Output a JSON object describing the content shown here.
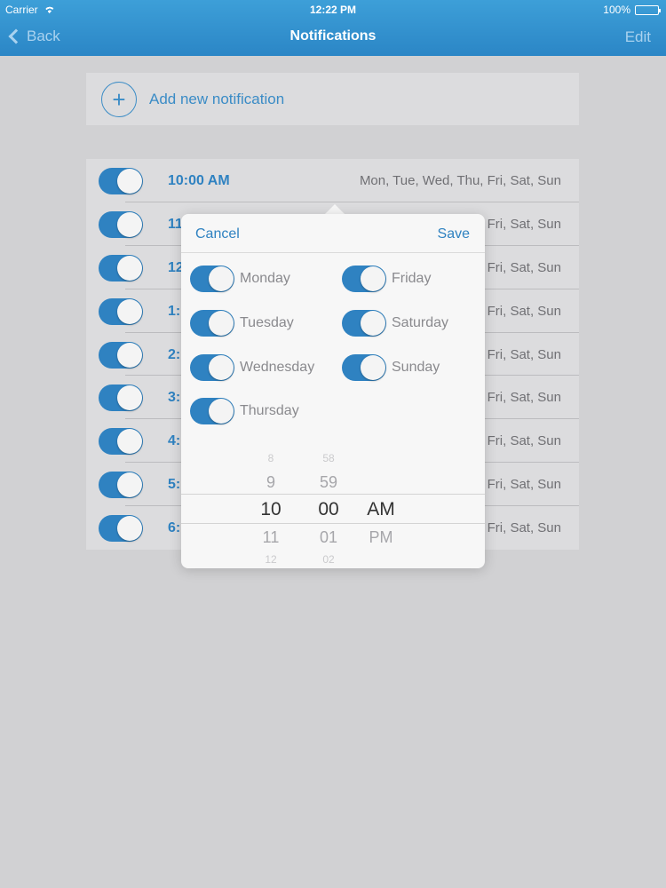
{
  "status": {
    "carrier": "Carrier",
    "time": "12:22 PM",
    "battery": "100%"
  },
  "nav": {
    "back": "Back",
    "title": "Notifications",
    "edit": "Edit"
  },
  "add": {
    "label": "Add new notification",
    "plus": "+"
  },
  "list": [
    {
      "time": "10:00 AM",
      "days": "Mon, Tue, Wed, Thu, Fri, Sat, Sun"
    },
    {
      "time": "11",
      "days": "Fri, Sat, Sun"
    },
    {
      "time": "12",
      "days": "Fri, Sat, Sun"
    },
    {
      "time": "1:",
      "days": "Fri, Sat, Sun"
    },
    {
      "time": "2:",
      "days": "Fri, Sat, Sun"
    },
    {
      "time": "3:",
      "days": "Fri, Sat, Sun"
    },
    {
      "time": "4:",
      "days": "Fri, Sat, Sun"
    },
    {
      "time": "5:",
      "days": "Fri, Sat, Sun"
    },
    {
      "time": "6:",
      "days": "Fri, Sat, Sun"
    }
  ],
  "popover": {
    "cancel": "Cancel",
    "save": "Save",
    "days": {
      "monday": "Monday",
      "tuesday": "Tuesday",
      "wednesday": "Wednesday",
      "thursday": "Thursday",
      "friday": "Friday",
      "saturday": "Saturday",
      "sunday": "Sunday"
    },
    "picker": {
      "hours": [
        "8",
        "9",
        "10",
        "11",
        "12"
      ],
      "minutes": [
        "58",
        "59",
        "00",
        "01",
        "02"
      ],
      "period": [
        "AM",
        "PM"
      ]
    }
  },
  "colors": {
    "accent": "#2f82c1",
    "navbar": "#3d9fd8",
    "background": "#d1d1d3"
  }
}
